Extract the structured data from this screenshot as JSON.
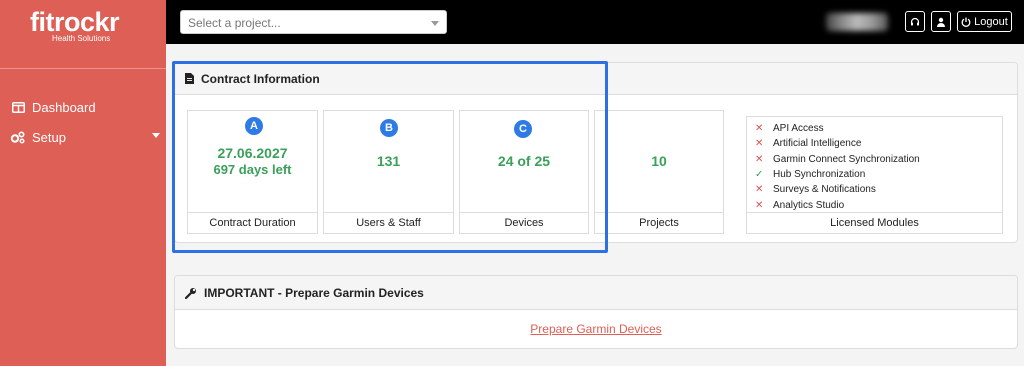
{
  "brand": {
    "name": "fitrockr",
    "tagline": "Health Solutions",
    "color": "#dd5f55"
  },
  "sidebar": {
    "items": [
      {
        "label": "Dashboard",
        "icon": "columns-icon"
      },
      {
        "label": "Setup",
        "icon": "gears-icon"
      }
    ]
  },
  "topbar": {
    "project_placeholder": "Select a project...",
    "logout_label": "Logout"
  },
  "contract": {
    "title": "Contract Information",
    "duration": {
      "badge": "A",
      "date": "27.06.2027",
      "days_left": "697 days left",
      "label": "Contract Duration"
    },
    "users": {
      "badge": "B",
      "value": "131",
      "label": "Users & Staff"
    },
    "devices": {
      "badge": "C",
      "value": "24 of 25",
      "label": "Devices"
    },
    "projects": {
      "value": "10",
      "label": "Projects"
    },
    "modules": {
      "label": "Licensed Modules",
      "items": [
        {
          "name": "API Access",
          "enabled": false
        },
        {
          "name": "Artificial Intelligence",
          "enabled": false
        },
        {
          "name": "Garmin Connect Synchronization",
          "enabled": false
        },
        {
          "name": "Hub Synchronization",
          "enabled": true
        },
        {
          "name": "Surveys & Notifications",
          "enabled": false
        },
        {
          "name": "Analytics Studio",
          "enabled": false
        }
      ]
    }
  },
  "garmin": {
    "title": "IMPORTANT - Prepare Garmin Devices",
    "link": "Prepare Garmin Devices"
  },
  "colors": {
    "accent_green": "#3aa05a",
    "badge_blue": "#2e7be6",
    "highlight_blue": "#2f6fe4",
    "cross_red": "#d9534f"
  }
}
